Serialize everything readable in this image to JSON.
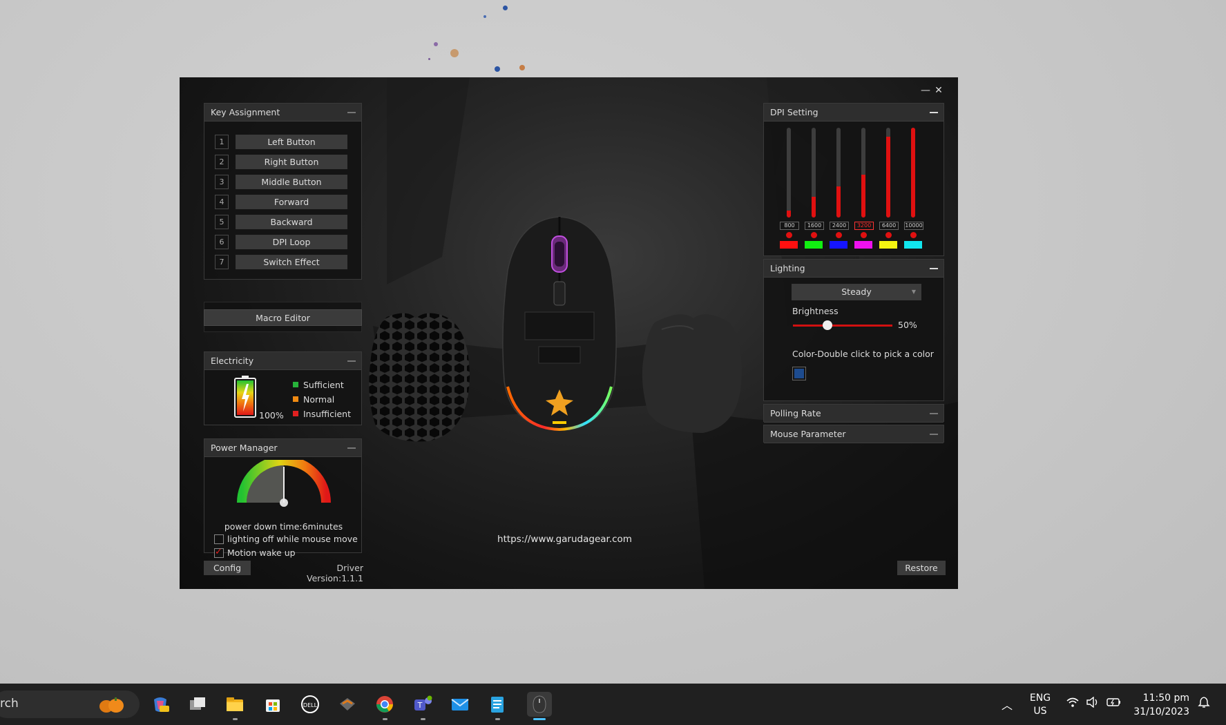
{
  "app": {
    "url": "https://www.garudagear.com",
    "driver_version": "Driver Version:1.1.1",
    "config_label": "Config",
    "restore_label": "Restore"
  },
  "key_assignment": {
    "title": "Key Assignment",
    "keys": [
      {
        "num": "1",
        "label": "Left Button"
      },
      {
        "num": "2",
        "label": "Right Button"
      },
      {
        "num": "3",
        "label": "Middle Button"
      },
      {
        "num": "4",
        "label": "Forward"
      },
      {
        "num": "5",
        "label": "Backward"
      },
      {
        "num": "6",
        "label": "DPI Loop"
      },
      {
        "num": "7",
        "label": "Switch Effect"
      }
    ]
  },
  "macro": {
    "label": "Macro Editor"
  },
  "electricity": {
    "title": "Electricity",
    "percent": "100%",
    "legend": [
      {
        "label": "Sufficient",
        "color": "#27b33a"
      },
      {
        "label": "Normal",
        "color": "#f08a12"
      },
      {
        "label": "Insufficient",
        "color": "#e02020"
      }
    ]
  },
  "power": {
    "title": "Power Manager",
    "down_time": "power down time:6minutes",
    "options": [
      {
        "label": "lighting off while mouse move",
        "checked": false
      },
      {
        "label": "Motion wake up",
        "checked": true
      }
    ]
  },
  "dpi": {
    "title": "DPI Setting",
    "levels": [
      {
        "value": "800",
        "fraction": 0.08,
        "color": "#ff1010",
        "selected": false
      },
      {
        "value": "1600",
        "fraction": 0.23,
        "color": "#11ee11",
        "selected": false
      },
      {
        "value": "2400",
        "fraction": 0.35,
        "color": "#1515ff",
        "selected": false
      },
      {
        "value": "3200",
        "fraction": 0.48,
        "color": "#ee11ee",
        "selected": true
      },
      {
        "value": "6400",
        "fraction": 0.9,
        "color": "#f5f511",
        "selected": false
      },
      {
        "value": "10000",
        "fraction": 1.0,
        "color": "#11e6ee",
        "selected": false
      }
    ]
  },
  "lighting": {
    "title": "Lighting",
    "mode": "Steady",
    "brightness_label": "Brightness",
    "brightness_value": "50%",
    "brightness_fraction": 0.35,
    "color_label": "Color-Double click to pick a color",
    "color": "#1d4b8e"
  },
  "polling": {
    "title": "Polling Rate"
  },
  "mouse_param": {
    "title": "Mouse Parameter"
  },
  "taskbar": {
    "search_text": "rch",
    "lang": "ENG",
    "region": "US",
    "time": "11:50 pm",
    "date": "31/10/2023",
    "icons": [
      "copilot-icon",
      "task-view-icon",
      "file-explorer-icon",
      "microsoft-store-icon",
      "dell-icon",
      "app-icon",
      "chrome-icon",
      "teams-icon",
      "mail-icon",
      "notepad-icon",
      "mouse-driver-icon"
    ]
  }
}
